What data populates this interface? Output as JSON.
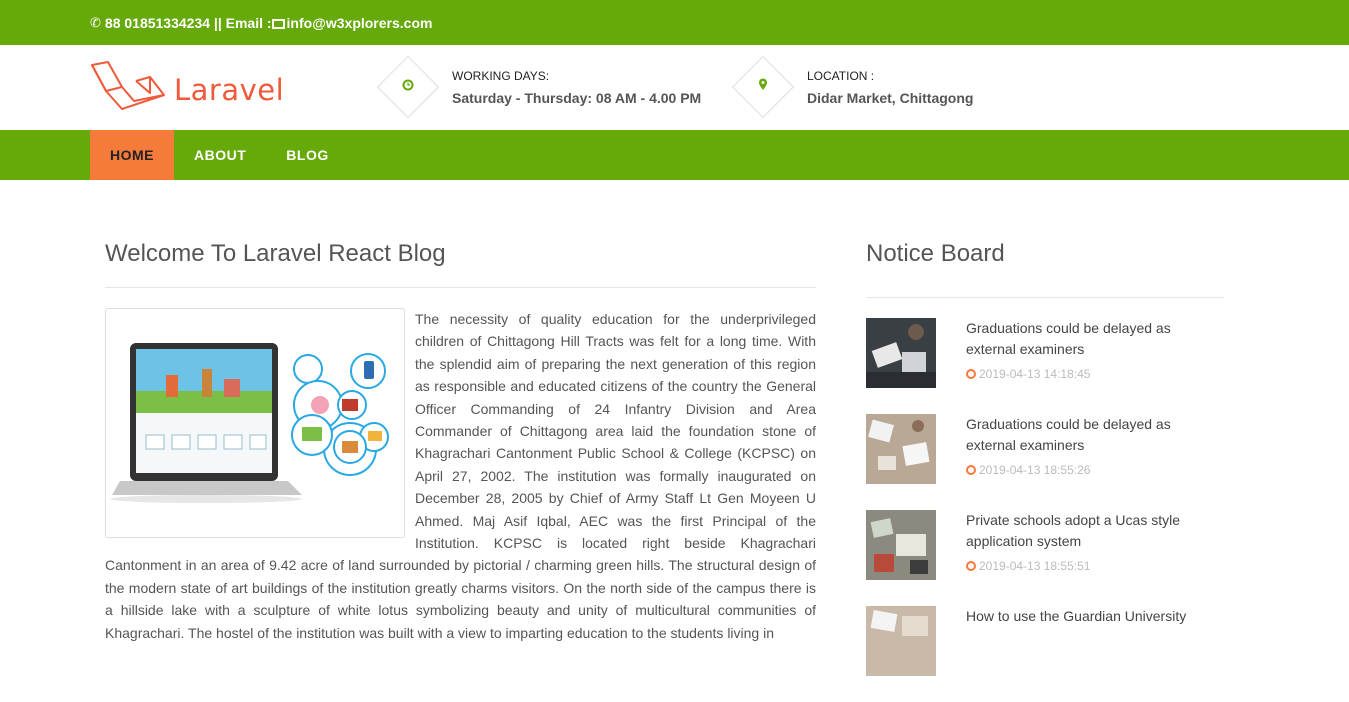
{
  "topbar": {
    "phone": "88 01851334234",
    "separator": "||",
    "email_label": "Email :",
    "email": "info@w3xplorers.com"
  },
  "brand": {
    "name": "Laravel",
    "color": "#ef5a3a"
  },
  "info": {
    "working_days_label": "WORKING DAYS:",
    "working_days_value": "Saturday - Thursday: 08 AM - 4.00 PM",
    "location_label": "LOCATION :",
    "location_value": "Didar Market, Chittagong"
  },
  "nav": {
    "items": [
      "HOME",
      "ABOUT",
      "BLOG"
    ],
    "active": "HOME"
  },
  "colors": {
    "primary_green": "#66aa0a",
    "accent_orange": "#f47b3a"
  },
  "main": {
    "title": "Welcome To Laravel React Blog",
    "body": "The necessity of quality education for the underprivileged children of Chittagong Hill Tracts was felt for a long time. With the splendid aim of preparing the next generation of this region as responsible and educated citizens of the country the General Officer Commanding of 24 Infantry Division and Area Commander of Chittagong area laid the foundation stone of Khagrachari Cantonment Public School & College (KCPSC) on April 27, 2002. The institution was formally inaugurated on December 28, 2005 by Chief of Army Staff Lt Gen Moyeen U Ahmed. Maj Asif Iqbal, AEC was the first Principal of the Institution. KCPSC is located right beside Khagrachari Cantonment in an area of 9.42 acre of land surrounded by pictorial / charming green hills. The structural design of the modern state of art buildings of the institution greatly charms visitors. On the north side of the campus there is a hillside lake with a sculpture of white lotus symbolizing beauty and unity of multicultural communities of Khagrachari. The hostel of the institution was built with a view to imparting education to the students living in"
  },
  "notice_board": {
    "title": "Notice Board",
    "items": [
      {
        "title": "Graduations could be delayed as external examiners",
        "date": "2019-04-13 14:18:45"
      },
      {
        "title": "Graduations could be delayed as external examiners",
        "date": "2019-04-13 18:55:26"
      },
      {
        "title": "Private schools adopt a Ucas style application system",
        "date": "2019-04-13 18:55:51"
      },
      {
        "title": "How to use the Guardian University",
        "date": ""
      }
    ]
  }
}
